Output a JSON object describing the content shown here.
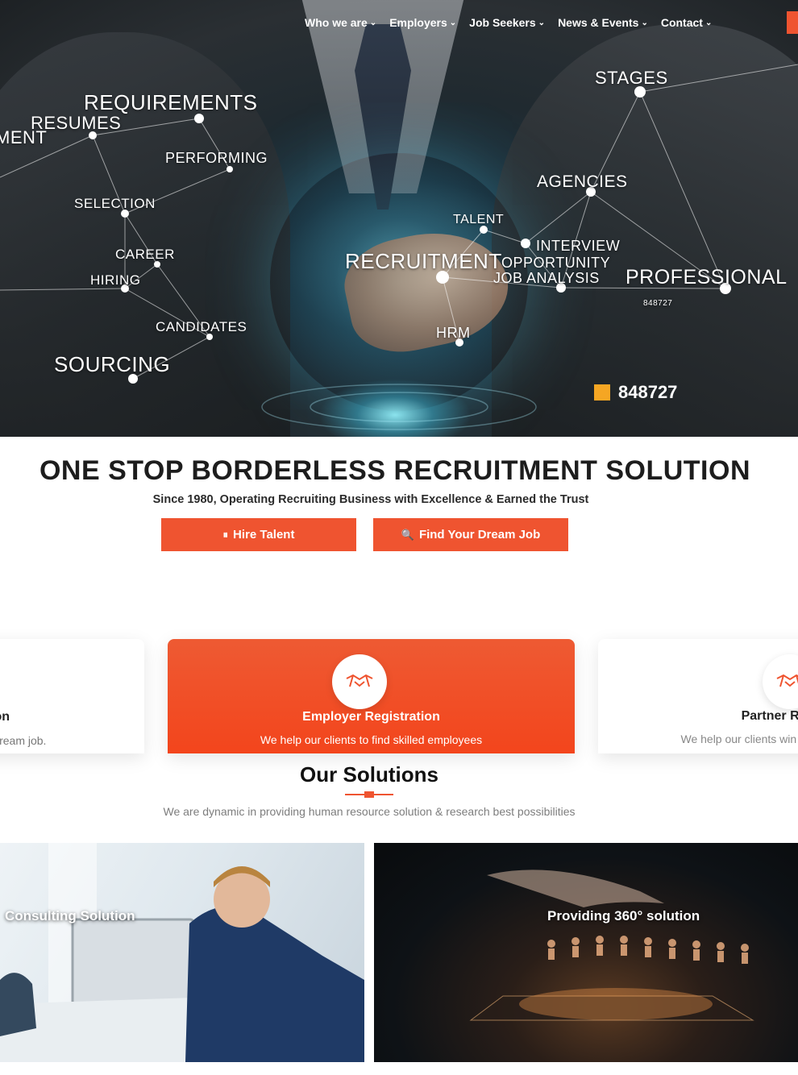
{
  "nav": {
    "items": [
      {
        "label": "Who we are"
      },
      {
        "label": "Employers"
      },
      {
        "label": "Job Seekers"
      },
      {
        "label": "News & Events"
      },
      {
        "label": "Contact"
      }
    ]
  },
  "hero": {
    "words": {
      "requirements": "REQUIREMENTS",
      "resumes": "RESUMES",
      "ment": "MENT",
      "performing": "PERFORMING",
      "selection": "SELECTION",
      "career": "CAREER",
      "hiring": "HIRING",
      "candidates": "CANDIDATES",
      "sourcing": "SOURCING",
      "stages": "STAGES",
      "agencies": "AGENCIES",
      "talent": "TALENT",
      "interview": "INTERVIEW",
      "opportunity": "OPPORTUNITY",
      "job_analysis": "JOB ANALYSIS",
      "recruitment": "RECRUITMENT",
      "professional": "PROFESSIONAL",
      "hrm": "HRM",
      "small_num": "848727"
    },
    "stat": "848727",
    "stat_color": "#f5a623"
  },
  "headline": {
    "title": "ONE STOP BORDERLESS RECRUITMENT SOLUTION",
    "subtitle": "Since 1980, Operating Recruiting Business with Excellence & Earned the Trust"
  },
  "buttons": {
    "hire": "Hire Talent",
    "find": "Find Your Dream Job",
    "accent": "#ef5430"
  },
  "cards": [
    {
      "title": "Candidate Registration",
      "desc": "We help candidates to find their dream job."
    },
    {
      "title": "Employer Registration",
      "desc": "We help our clients to find skilled employees"
    },
    {
      "title": "Partner Registration",
      "desc": "We help our clients win and grow in their industry"
    }
  ],
  "solutions": {
    "title": "Our Solutions",
    "subtitle": "We are dynamic in providing human resource solution & research best possibilities",
    "tiles": [
      {
        "label": "Consulting Solution"
      },
      {
        "label": "Providing 360° solution"
      }
    ]
  }
}
